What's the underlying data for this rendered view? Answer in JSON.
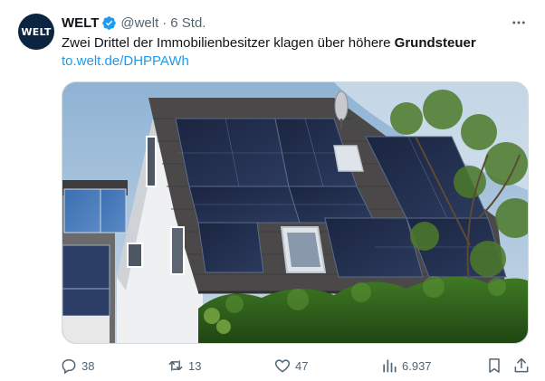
{
  "author": {
    "avatar_text": "WELT",
    "name": "WELT",
    "handle": "@welt",
    "separator": "·",
    "time": "6 Std."
  },
  "tweet": {
    "text_plain": "Zwei Drittel der Immobilienbesitzer klagen über höhere ",
    "text_bold": "Grundsteuer",
    "link": "to.welt.de/DHPPAWh"
  },
  "media": {
    "description_icon": "photo-house-solar-roof"
  },
  "actions": {
    "replies": "38",
    "reposts": "13",
    "likes": "47",
    "views": "6.937"
  },
  "colors": {
    "accent": "#1d9bf0",
    "secondary_text": "#536471",
    "avatar_bg": "#0b2540"
  },
  "icons": {
    "more": "more-icon",
    "verified": "verified-badge-icon",
    "reply": "reply-icon",
    "repost": "repost-icon",
    "like": "like-icon",
    "views": "views-icon",
    "bookmark": "bookmark-icon",
    "share": "share-icon"
  }
}
